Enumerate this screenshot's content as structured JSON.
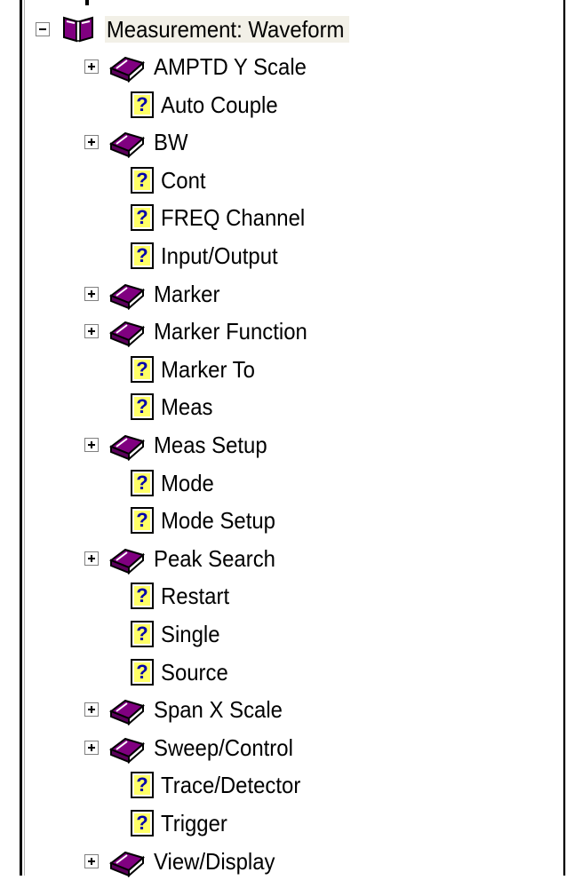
{
  "tree": {
    "root": {
      "label": "Measurement: Waveform",
      "expanded": true
    },
    "children": [
      {
        "label": "AMPTD Y Scale",
        "type": "book",
        "expandable": true
      },
      {
        "label": "Auto Couple",
        "type": "help",
        "expandable": false
      },
      {
        "label": "BW",
        "type": "book",
        "expandable": true
      },
      {
        "label": "Cont",
        "type": "help",
        "expandable": false
      },
      {
        "label": "FREQ Channel",
        "type": "help",
        "expandable": false
      },
      {
        "label": "Input/Output",
        "type": "help",
        "expandable": false
      },
      {
        "label": "Marker",
        "type": "book",
        "expandable": true
      },
      {
        "label": "Marker Function",
        "type": "book",
        "expandable": true
      },
      {
        "label": "Marker To",
        "type": "help",
        "expandable": false
      },
      {
        "label": "Meas",
        "type": "help",
        "expandable": false
      },
      {
        "label": "Meas Setup",
        "type": "book",
        "expandable": true
      },
      {
        "label": "Mode",
        "type": "help",
        "expandable": false
      },
      {
        "label": "Mode Setup",
        "type": "help",
        "expandable": false
      },
      {
        "label": "Peak Search",
        "type": "book",
        "expandable": true
      },
      {
        "label": "Restart",
        "type": "help",
        "expandable": false
      },
      {
        "label": "Single",
        "type": "help",
        "expandable": false
      },
      {
        "label": "Source",
        "type": "help",
        "expandable": false
      },
      {
        "label": "Span X Scale",
        "type": "book",
        "expandable": true
      },
      {
        "label": "Sweep/Control",
        "type": "book",
        "expandable": true
      },
      {
        "label": "Trace/Detector",
        "type": "help",
        "expandable": false
      },
      {
        "label": "Trigger",
        "type": "help",
        "expandable": false
      },
      {
        "label": "View/Display",
        "type": "book",
        "expandable": true
      }
    ]
  },
  "icons": {
    "root": "open-book-icon",
    "book": "closed-book-icon",
    "help": "help-topic-icon",
    "help_glyph": "?"
  },
  "colors": {
    "book_purple": "#800080",
    "help_yellow": "#ffff66",
    "help_blue": "#0000aa",
    "root_highlight": "#f2f0e7"
  }
}
